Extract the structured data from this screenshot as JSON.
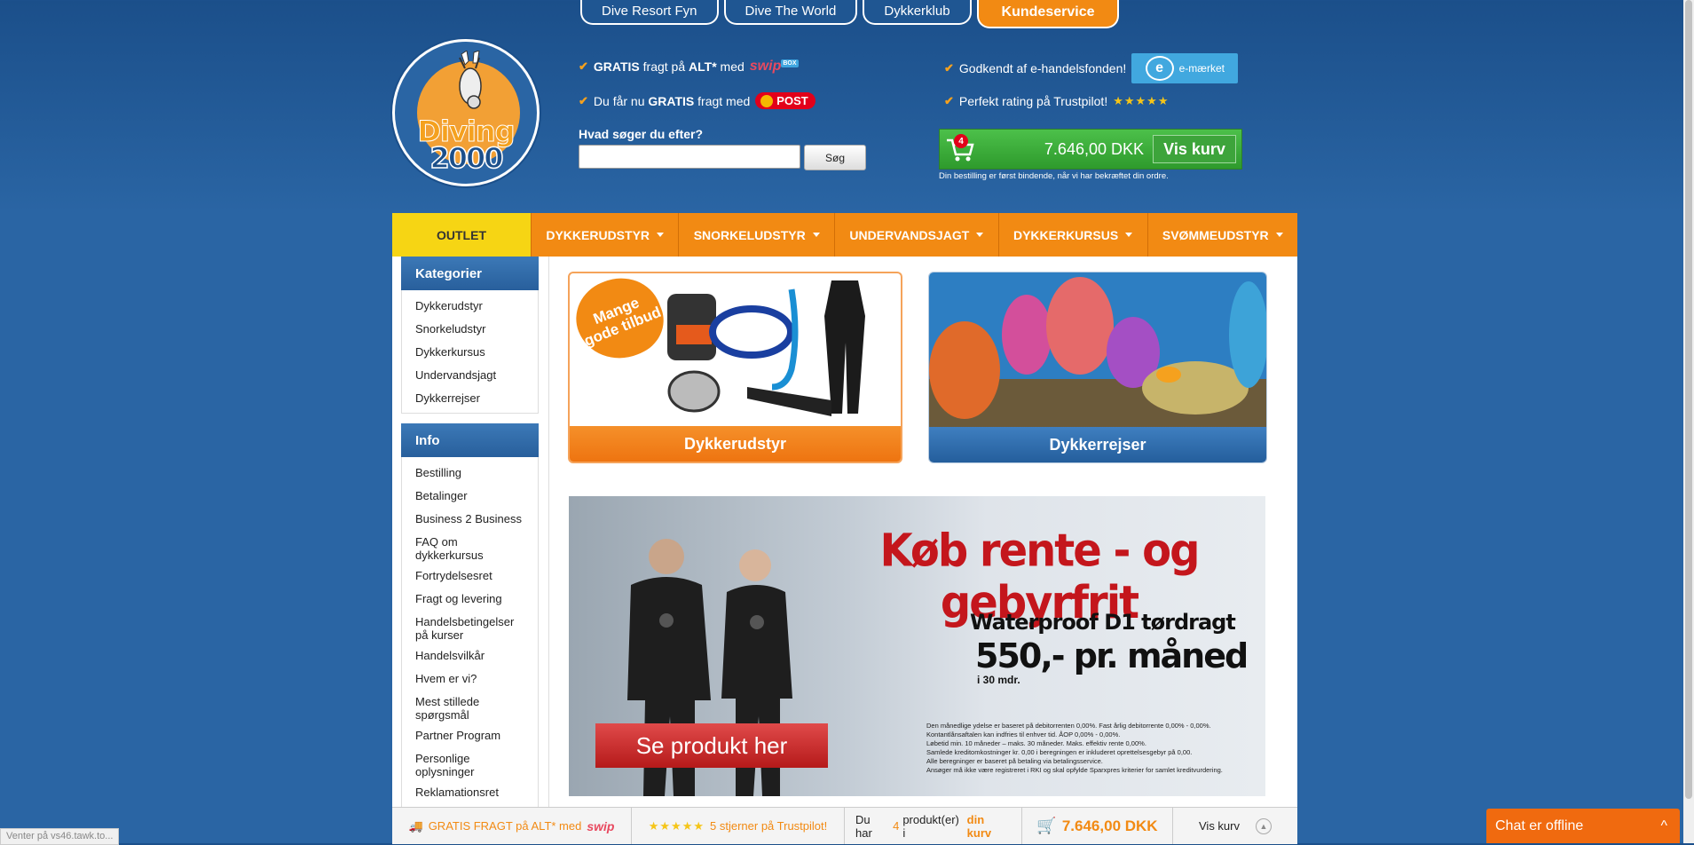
{
  "top_tabs": [
    "Dive Resort Fyn",
    "Dive The World",
    "Dykkerklub",
    "Kundeservice"
  ],
  "logo": {
    "line1": "Diving",
    "line2": "2000"
  },
  "usp": {
    "free_shipping_bold": "GRATIS",
    "free_shipping_mid": "fragt på",
    "free_shipping_all": "ALT*",
    "free_shipping_with": "med",
    "swipbox": "swip",
    "swipbox_tag": "BOX",
    "post_prefix": "Du får nu",
    "post_bold": "GRATIS",
    "post_suffix": "fragt med",
    "post_logo": "POST",
    "approved": "Godkendt af e-handelsfonden!",
    "emaerket": "e-mærket",
    "trustpilot": "Perfekt rating på Trustpilot!",
    "stars": "★★★★★"
  },
  "search": {
    "label": "Hvad søger du efter?",
    "value": "",
    "button": "Søg"
  },
  "cart": {
    "count": "4",
    "amount": "7.646,00 DKK",
    "button": "Vis kurv",
    "note": "Din bestilling er først bindende, når vi har bekræftet din ordre."
  },
  "nav": {
    "outlet": "OUTLET",
    "items": [
      "DYKKERUDSTYR",
      "SNORKELUDSTYR",
      "UNDERVANDSJAGT",
      "DYKKERKURSUS",
      "SVØMMEUDSTYR"
    ]
  },
  "sidebar": {
    "categories_title": "Kategorier",
    "categories": [
      "Dykkerudstyr",
      "Snorkeludstyr",
      "Dykkerkursus",
      "Undervandsjagt",
      "Dykkerrejser"
    ],
    "info_title": "Info",
    "info": [
      "Bestilling",
      "Betalinger",
      "Business 2 Business",
      "FAQ om dykkerkursus",
      "Fortrydelsesret",
      "Fragt og levering",
      "Handelsbetingelser på kurser",
      "Handelsvilkår",
      "Hvem er vi?",
      "Mest stillede spørgsmål",
      "Partner Program",
      "Personlige oplysninger",
      "Reklamationsret"
    ]
  },
  "cards": {
    "equipment_label": "Dykkerudstyr",
    "equipment_splash": "Mange gode tilbud",
    "travel_label": "Dykkerrejser"
  },
  "banner": {
    "title": "Køb rente - og gebyrfrit",
    "subtitle": "Waterproof D1 tørdragt",
    "price": "550,- pr. måned",
    "price_note": "i 30 mdr.",
    "button": "Se produkt her",
    "fine_print": [
      "Den månedlige ydelse er baseret på debitorrenten 0,00%.  Fast årlig debitorrente 0,00% - 0,00%.",
      "Kontantlånsaftalen kan indfries til enhver tid.  ÅOP 0,00% - 0,00%.",
      "Løbetid min. 10 måneder – maks. 30 måneder.  Maks. effektiv rente 0,00%.",
      "Samlede kreditomkostninger kr. 0,00 i beregningen er inkluderet oprettelsesgebyr på 0,00.",
      "Alle beregninger er baseret på betaling via betalingsservice.",
      "Ansøger må ikke være registreret i RKI og skal opfylde Sparxpres kriterier for samlet kreditvurdering."
    ]
  },
  "bottom_bar": {
    "shipping_text": "GRATIS FRAGT på ALT* med",
    "swipbox": "swip",
    "stars": "★★★★★",
    "trustpilot": "5 stjerner på Trustpilot!",
    "cart_prefix": "Du har",
    "cart_count": "4",
    "cart_mid": "produkt(er) i",
    "cart_link": "din kurv",
    "price": "7.646,00 DKK",
    "view_cart": "Vis kurv"
  },
  "status_text": "Venter på vs46.tawk.to...",
  "chat": {
    "label": "Chat er offline",
    "chevron": "^"
  },
  "colors": {
    "accent": "#f28a13",
    "brand_blue": "#2a65a4",
    "cart_green": "#3da43b",
    "outlet_yellow": "#f6d514",
    "banner_red": "#c4161c"
  }
}
